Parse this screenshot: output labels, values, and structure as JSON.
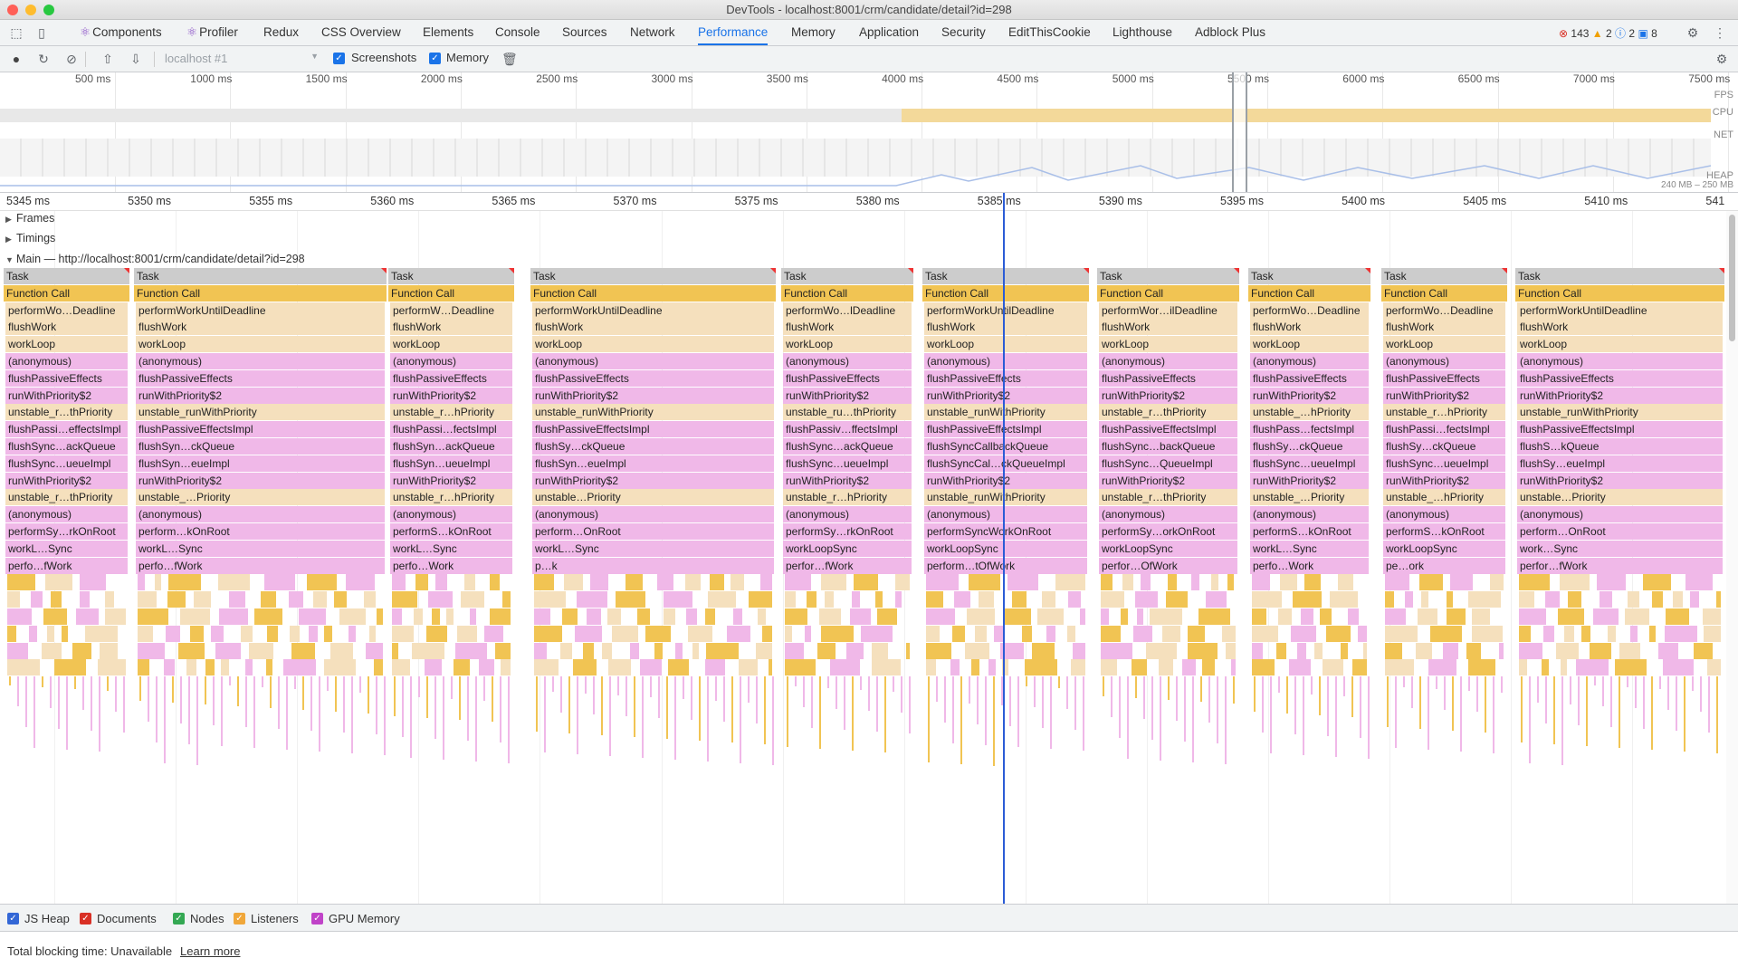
{
  "window": {
    "title": "DevTools - localhost:8001/crm/candidate/detail?id=298"
  },
  "tabs": [
    {
      "label": "Components",
      "react": true
    },
    {
      "label": "Profiler",
      "react": true
    },
    {
      "label": "Redux"
    },
    {
      "label": "CSS Overview"
    },
    {
      "label": "Elements"
    },
    {
      "label": "Console"
    },
    {
      "label": "Sources"
    },
    {
      "label": "Network"
    },
    {
      "label": "Performance",
      "active": true
    },
    {
      "label": "Memory"
    },
    {
      "label": "Application"
    },
    {
      "label": "Security"
    },
    {
      "label": "EditThisCookie"
    },
    {
      "label": "Lighthouse"
    },
    {
      "label": "Adblock Plus"
    }
  ],
  "counters": {
    "errors": "143",
    "warnings": "2",
    "info": "2",
    "messages": "8"
  },
  "toolbar": {
    "target_placeholder": "localhost #1",
    "screenshots_label": "Screenshots",
    "memory_label": "Memory"
  },
  "overview": {
    "ticks": [
      "500 ms",
      "1000 ms",
      "1500 ms",
      "2000 ms",
      "2500 ms",
      "3000 ms",
      "3500 ms",
      "4000 ms",
      "4500 ms",
      "5000 ms",
      "5500 ms",
      "6000 ms",
      "6500 ms",
      "7000 ms",
      "7500 ms"
    ],
    "fps_label": "FPS",
    "cpu_label": "CPU",
    "net_label": "NET",
    "heap_label": "HEAP",
    "heap_range": "240 MB – 250 MB"
  },
  "detail": {
    "ticks": [
      "5345 ms",
      "5350 ms",
      "5355 ms",
      "5360 ms",
      "5365 ms",
      "5370 ms",
      "5375 ms",
      "5380 ms",
      "5385 ms",
      "5390 ms",
      "5395 ms",
      "5400 ms",
      "5405 ms",
      "5410 ms",
      "541"
    ],
    "frames_label": "Frames",
    "timings_label": "Timings",
    "main_label": "Main — http://localhost:8001/crm/candidate/detail?id=298"
  },
  "flame_labels": {
    "task": "Task",
    "function_call": "Function Call",
    "rows": [
      "performWorkUntilDeadline",
      "flushWork",
      "workLoop",
      "(anonymous)",
      "flushPassiveEffects",
      "runWithPriority$2",
      "unstable_runWithPriority",
      "flushPassiveEffectsImpl",
      "flushSyncCallbackQueue",
      "flushSyncCallbackQueueImpl",
      "runWithPriority$2",
      "unstable_runWithPriority",
      "(anonymous)",
      "performSyncWorkOnRoot",
      "workLoopSync",
      "performUnitOfWork"
    ]
  },
  "flame_columns": [
    [
      "performWo…Deadline",
      "flushWork",
      "workLoop",
      "(anonymous)",
      "flushPassiveEffects",
      "runWithPriority$2",
      "unstable_r…thPriority",
      "flushPassi…effectsImpl",
      "flushSync…ackQueue",
      "flushSync…ueueImpl",
      "runWithPriority$2",
      "unstable_r…thPriority",
      "(anonymous)",
      "performSy…rkOnRoot",
      "workL…Sync",
      "perfo…fWork"
    ],
    [
      "performWorkUntilDeadline",
      "flushWork",
      "workLoop",
      "(anonymous)",
      "flushPassiveEffects",
      "runWithPriority$2",
      "unstable_runWithPriority",
      "flushPassiveEffectsImpl",
      "flushSyn…ckQueue",
      "flushSyn…eueImpl",
      "runWithPriority$2",
      "unstable_…Priority",
      "(anonymous)",
      "perform…kOnRoot",
      "workL…Sync",
      "perfo…fWork"
    ],
    [
      "performW…Deadline",
      "flushWork",
      "workLoop",
      "(anonymous)",
      "flushPassiveEffects",
      "runWithPriority$2",
      "unstable_r…hPriority",
      "flushPassi…fectsImpl",
      "flushSyn…ackQueue",
      "flushSyn…ueueImpl",
      "runWithPriority$2",
      "unstable_r…hPriority",
      "(anonymous)",
      "performS…kOnRoot",
      "workL…Sync",
      "perfo…Work"
    ],
    [
      "performWorkUntilDeadline",
      "flushWork",
      "workLoop",
      "(anonymous)",
      "flushPassiveEffects",
      "runWithPriority$2",
      "unstable_runWithPriority",
      "flushPassiveEffectsImpl",
      "flushSy…ckQueue",
      "flushSyn…eueImpl",
      "runWithPriority$2",
      "unstable…Priority",
      "(anonymous)",
      "perform…OnRoot",
      "workL…Sync",
      "p…k"
    ],
    [
      "performWo…lDeadline",
      "flushWork",
      "workLoop",
      "(anonymous)",
      "flushPassiveEffects",
      "runWithPriority$2",
      "unstable_ru…thPriority",
      "flushPassiv…ffectsImpl",
      "flushSync…ackQueue",
      "flushSync…ueueImpl",
      "runWithPriority$2",
      "unstable_r…hPriority",
      "(anonymous)",
      "performSy…rkOnRoot",
      "workLoopSync",
      "perfor…fWork"
    ],
    [
      "performWorkUntilDeadline",
      "flushWork",
      "workLoop",
      "(anonymous)",
      "flushPassiveEffects",
      "runWithPriority$2",
      "unstable_runWithPriority",
      "flushPassiveEffectsImpl",
      "flushSyncCallbackQueue",
      "flushSyncCal…ckQueueImpl",
      "runWithPriority$2",
      "unstable_runWithPriority",
      "(anonymous)",
      "performSyncWorkOnRoot",
      "workLoopSync",
      "perform…tOfWork"
    ],
    [
      "performWor…ilDeadline",
      "flushWork",
      "workLoop",
      "(anonymous)",
      "flushPassiveEffects",
      "runWithPriority$2",
      "unstable_r…thPriority",
      "flushPassiveEffectsImpl",
      "flushSync…backQueue",
      "flushSync…QueueImpl",
      "runWithPriority$2",
      "unstable_r…thPriority",
      "(anonymous)",
      "performSy…orkOnRoot",
      "workLoopSync",
      "perfor…OfWork"
    ],
    [
      "performWo…Deadline",
      "flushWork",
      "workLoop",
      "(anonymous)",
      "flushPassiveEffects",
      "runWithPriority$2",
      "unstable_…hPriority",
      "flushPass…fectsImpl",
      "flushSy…ckQueue",
      "flushSync…ueueImpl",
      "runWithPriority$2",
      "unstable_…Priority",
      "(anonymous)",
      "performS…kOnRoot",
      "workL…Sync",
      "perfo…Work"
    ],
    [
      "performWo…Deadline",
      "flushWork",
      "workLoop",
      "(anonymous)",
      "flushPassiveEffects",
      "runWithPriority$2",
      "unstable_r…hPriority",
      "flushPassi…fectsImpl",
      "flushSy…ckQueue",
      "flushSync…ueueImpl",
      "runWithPriority$2",
      "unstable_…hPriority",
      "(anonymous)",
      "performS…kOnRoot",
      "workLoopSync",
      "pe…ork"
    ],
    [
      "performWorkUntilDeadline",
      "flushWork",
      "workLoop",
      "(anonymous)",
      "flushPassiveEffects",
      "runWithPriority$2",
      "unstable_runWithPriority",
      "flushPassiveEffectsImpl",
      "flushS…kQueue",
      "flushSy…eueImpl",
      "runWithPriority$2",
      "unstable…Priority",
      "(anonymous)",
      "perform…OnRoot",
      "work…Sync",
      "perfor…fWork"
    ]
  ],
  "memory_counters": [
    {
      "label": "JS Heap",
      "color": "#3367d6"
    },
    {
      "label": "Documents",
      "color": "#d93025"
    },
    {
      "label": "Nodes",
      "color": "#34a853"
    },
    {
      "label": "Listeners",
      "color": "#f0a73a"
    },
    {
      "label": "GPU Memory",
      "color": "#c043c8"
    }
  ],
  "status": {
    "text": "Total blocking time: Unavailable",
    "link": "Learn more"
  }
}
